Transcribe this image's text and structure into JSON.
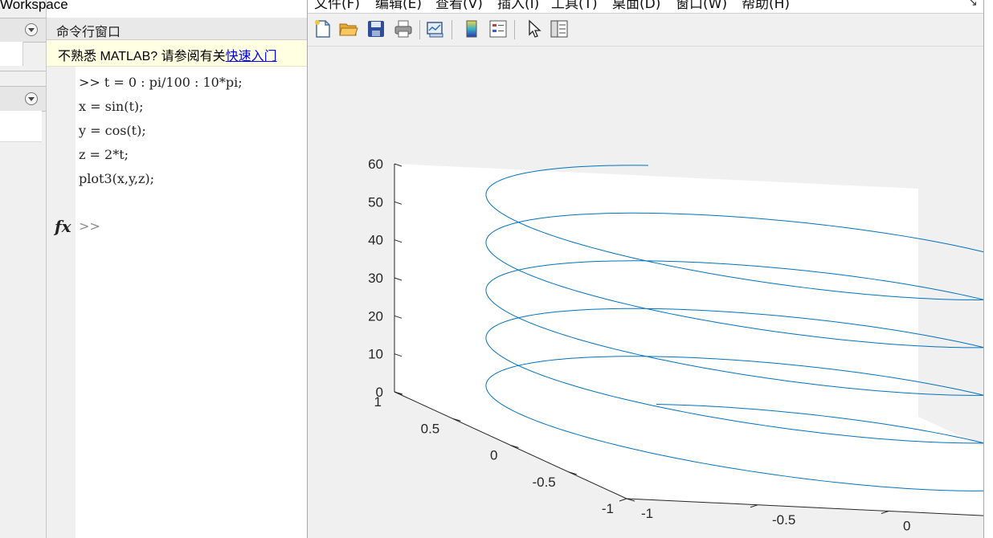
{
  "workspace": {
    "title": "Workspace"
  },
  "command_window": {
    "title": "命令行窗口",
    "notice_prefix": "不熟悉 MATLAB? 请参阅有关",
    "notice_link": "快速入门",
    "lines": [
      ">> t = 0 : pi/100 : 10*pi;",
      "x = sin(t);",
      "y = cos(t);",
      "z = 2*t;",
      "plot3(x,y,z);"
    ],
    "prompt_icon": "fx",
    "prompt": ">>"
  },
  "figure": {
    "menu": [
      "文件(F)",
      "编辑(E)",
      "查看(V)",
      "插入(I)",
      "工具(T)",
      "桌面(D)",
      "窗口(W)",
      "帮助(H)"
    ],
    "toolbar_icons": [
      "new-figure-icon",
      "open-file-icon",
      "save-icon",
      "print-icon",
      "link-plot-icon",
      "colorbar-icon",
      "legend-icon",
      "pointer-icon",
      "property-inspector-icon"
    ],
    "line_color": "#0072bd",
    "background_color": "#f0f0f0"
  },
  "chart_data": {
    "type": "line",
    "projection": "3d",
    "parametric": {
      "t_start": 0,
      "t_end": 31.4159,
      "t_step": 0.031416,
      "x": "sin(t)",
      "y": "cos(t)",
      "z": "2*t"
    },
    "xlim": [
      -1,
      1
    ],
    "ylim": [
      -1,
      1
    ],
    "zlim": [
      0,
      60
    ],
    "x_ticks": [
      "-1",
      "-0.5",
      "0",
      "0.5",
      "1"
    ],
    "y_ticks": [
      "-1",
      "-0.5",
      "0",
      "0.5",
      "1"
    ],
    "z_ticks": [
      "0",
      "10",
      "20",
      "30",
      "40",
      "50",
      "60"
    ],
    "title": "",
    "xlabel": "",
    "ylabel": "",
    "zlabel": "",
    "grid": false
  }
}
